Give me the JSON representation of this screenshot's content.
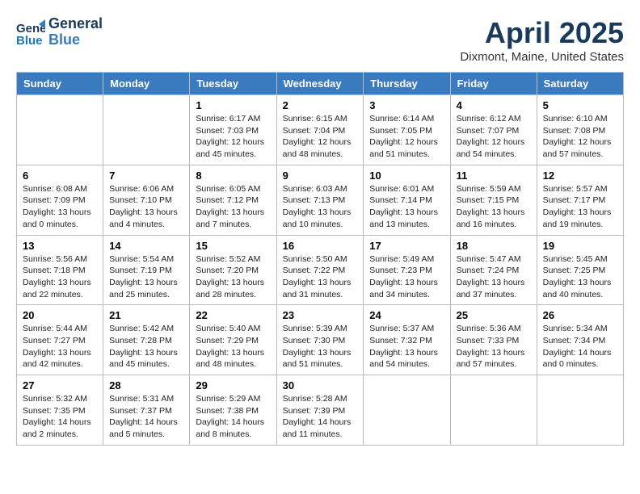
{
  "header": {
    "logo_line1": "General",
    "logo_line2": "Blue",
    "title": "April 2025",
    "location": "Dixmont, Maine, United States"
  },
  "weekdays": [
    "Sunday",
    "Monday",
    "Tuesday",
    "Wednesday",
    "Thursday",
    "Friday",
    "Saturday"
  ],
  "weeks": [
    [
      {
        "day": "",
        "info": ""
      },
      {
        "day": "",
        "info": ""
      },
      {
        "day": "1",
        "info": "Sunrise: 6:17 AM\nSunset: 7:03 PM\nDaylight: 12 hours\nand 45 minutes."
      },
      {
        "day": "2",
        "info": "Sunrise: 6:15 AM\nSunset: 7:04 PM\nDaylight: 12 hours\nand 48 minutes."
      },
      {
        "day": "3",
        "info": "Sunrise: 6:14 AM\nSunset: 7:05 PM\nDaylight: 12 hours\nand 51 minutes."
      },
      {
        "day": "4",
        "info": "Sunrise: 6:12 AM\nSunset: 7:07 PM\nDaylight: 12 hours\nand 54 minutes."
      },
      {
        "day": "5",
        "info": "Sunrise: 6:10 AM\nSunset: 7:08 PM\nDaylight: 12 hours\nand 57 minutes."
      }
    ],
    [
      {
        "day": "6",
        "info": "Sunrise: 6:08 AM\nSunset: 7:09 PM\nDaylight: 13 hours\nand 0 minutes."
      },
      {
        "day": "7",
        "info": "Sunrise: 6:06 AM\nSunset: 7:10 PM\nDaylight: 13 hours\nand 4 minutes."
      },
      {
        "day": "8",
        "info": "Sunrise: 6:05 AM\nSunset: 7:12 PM\nDaylight: 13 hours\nand 7 minutes."
      },
      {
        "day": "9",
        "info": "Sunrise: 6:03 AM\nSunset: 7:13 PM\nDaylight: 13 hours\nand 10 minutes."
      },
      {
        "day": "10",
        "info": "Sunrise: 6:01 AM\nSunset: 7:14 PM\nDaylight: 13 hours\nand 13 minutes."
      },
      {
        "day": "11",
        "info": "Sunrise: 5:59 AM\nSunset: 7:15 PM\nDaylight: 13 hours\nand 16 minutes."
      },
      {
        "day": "12",
        "info": "Sunrise: 5:57 AM\nSunset: 7:17 PM\nDaylight: 13 hours\nand 19 minutes."
      }
    ],
    [
      {
        "day": "13",
        "info": "Sunrise: 5:56 AM\nSunset: 7:18 PM\nDaylight: 13 hours\nand 22 minutes."
      },
      {
        "day": "14",
        "info": "Sunrise: 5:54 AM\nSunset: 7:19 PM\nDaylight: 13 hours\nand 25 minutes."
      },
      {
        "day": "15",
        "info": "Sunrise: 5:52 AM\nSunset: 7:20 PM\nDaylight: 13 hours\nand 28 minutes."
      },
      {
        "day": "16",
        "info": "Sunrise: 5:50 AM\nSunset: 7:22 PM\nDaylight: 13 hours\nand 31 minutes."
      },
      {
        "day": "17",
        "info": "Sunrise: 5:49 AM\nSunset: 7:23 PM\nDaylight: 13 hours\nand 34 minutes."
      },
      {
        "day": "18",
        "info": "Sunrise: 5:47 AM\nSunset: 7:24 PM\nDaylight: 13 hours\nand 37 minutes."
      },
      {
        "day": "19",
        "info": "Sunrise: 5:45 AM\nSunset: 7:25 PM\nDaylight: 13 hours\nand 40 minutes."
      }
    ],
    [
      {
        "day": "20",
        "info": "Sunrise: 5:44 AM\nSunset: 7:27 PM\nDaylight: 13 hours\nand 42 minutes."
      },
      {
        "day": "21",
        "info": "Sunrise: 5:42 AM\nSunset: 7:28 PM\nDaylight: 13 hours\nand 45 minutes."
      },
      {
        "day": "22",
        "info": "Sunrise: 5:40 AM\nSunset: 7:29 PM\nDaylight: 13 hours\nand 48 minutes."
      },
      {
        "day": "23",
        "info": "Sunrise: 5:39 AM\nSunset: 7:30 PM\nDaylight: 13 hours\nand 51 minutes."
      },
      {
        "day": "24",
        "info": "Sunrise: 5:37 AM\nSunset: 7:32 PM\nDaylight: 13 hours\nand 54 minutes."
      },
      {
        "day": "25",
        "info": "Sunrise: 5:36 AM\nSunset: 7:33 PM\nDaylight: 13 hours\nand 57 minutes."
      },
      {
        "day": "26",
        "info": "Sunrise: 5:34 AM\nSunset: 7:34 PM\nDaylight: 14 hours\nand 0 minutes."
      }
    ],
    [
      {
        "day": "27",
        "info": "Sunrise: 5:32 AM\nSunset: 7:35 PM\nDaylight: 14 hours\nand 2 minutes."
      },
      {
        "day": "28",
        "info": "Sunrise: 5:31 AM\nSunset: 7:37 PM\nDaylight: 14 hours\nand 5 minutes."
      },
      {
        "day": "29",
        "info": "Sunrise: 5:29 AM\nSunset: 7:38 PM\nDaylight: 14 hours\nand 8 minutes."
      },
      {
        "day": "30",
        "info": "Sunrise: 5:28 AM\nSunset: 7:39 PM\nDaylight: 14 hours\nand 11 minutes."
      },
      {
        "day": "",
        "info": ""
      },
      {
        "day": "",
        "info": ""
      },
      {
        "day": "",
        "info": ""
      }
    ]
  ]
}
